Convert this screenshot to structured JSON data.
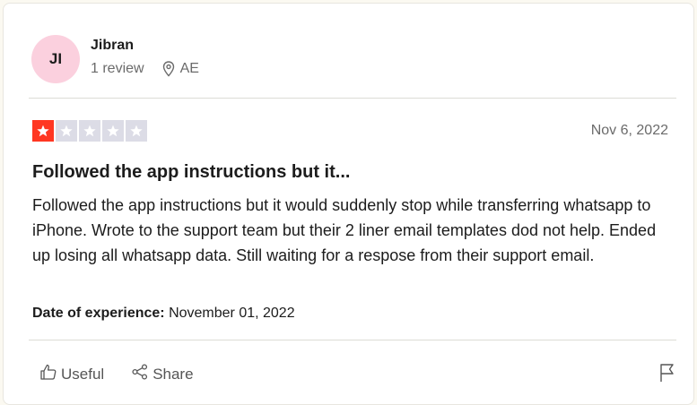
{
  "reviewer": {
    "initials": "JI",
    "name": "Jibran",
    "review_count": "1 review",
    "country": "AE",
    "avatar_color": "#fbd0de"
  },
  "review": {
    "rating": 1,
    "max_rating": 5,
    "date": "Nov 6, 2022",
    "title": "Followed the app instructions but it...",
    "body": "Followed the app instructions but it would suddenly stop while transferring whatsapp to iPhone. Wrote to the support team but their 2 liner email templates dod not help. Ended up losing all whatsapp data. Still waiting for a respose from their support email.",
    "experience_label": "Date of experience:",
    "experience_date": "November 01, 2022"
  },
  "actions": {
    "useful_label": "Useful",
    "share_label": "Share"
  },
  "icons": {
    "location": "location-pin-icon",
    "useful": "thumbs-up-icon",
    "share": "share-icon",
    "report": "flag-icon",
    "star": "star-icon"
  },
  "colors": {
    "star_filled": "#ff3722",
    "star_empty": "#dcdce6",
    "page_background": "#fbf9f1"
  }
}
